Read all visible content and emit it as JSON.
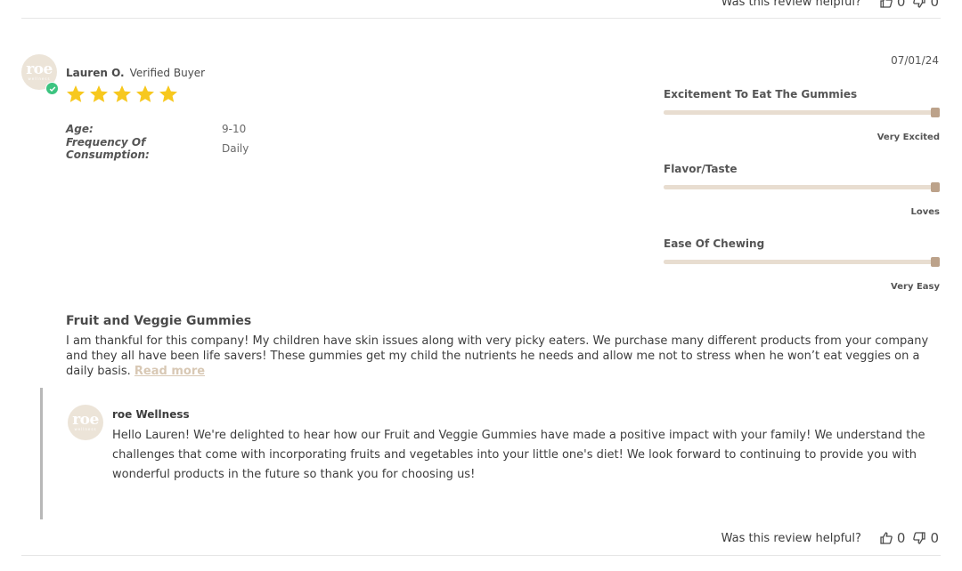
{
  "helpful": {
    "label": "Was this review helpful?",
    "upvotes": "0",
    "downvotes": "0"
  },
  "review": {
    "reviewer_name": "Lauren O.",
    "verified_label": "Verified Buyer",
    "date": "07/01/24",
    "rating": 5,
    "avatar_logo": "roe",
    "avatar_logo_sub": "wellness",
    "attributes": [
      {
        "key": "Age:",
        "value": "9-10"
      },
      {
        "key": "Frequency Of Consumption:",
        "value": "Daily"
      }
    ],
    "sliders": [
      {
        "title": "Excitement To Eat The Gummies",
        "value_label": "Very Excited",
        "level": 1.0
      },
      {
        "title": "Flavor/Taste",
        "value_label": "Loves",
        "level": 1.0
      },
      {
        "title": "Ease Of Chewing",
        "value_label": "Very Easy",
        "level": 1.0
      }
    ],
    "title": "Fruit and Veggie Gummies",
    "body": "I am thankful for this company! My children have skin issues along with very picky eaters. We purchase many different products from your company and they all have been life savers! These gummies get my child the nutrients he needs and allow me not to stress when he won’t eat veggies on a daily basis.",
    "read_more": "Read more"
  },
  "reply": {
    "name": "roe Wellness",
    "body": "Hello Lauren! We're delighted to hear how our Fruit and Veggie Gummies have made a positive impact with your family! We understand the challenges that come with incorporating fruits and vegetables into your little one's diet! We look forward to continuing to provide you with wonderful products in the future so thank you for choosing us!"
  },
  "colors": {
    "star": "#f7c81e",
    "verified_badge": "#3cc480",
    "slider_track": "#e8ddd0",
    "slider_knob": "#bca28a",
    "read_more": "#d8c8b4",
    "avatar_bg": "#ece4d8"
  },
  "icons": {
    "thumbs_up": "thumbs-up-icon",
    "thumbs_down": "thumbs-down-icon",
    "star": "star-icon",
    "check": "check-icon"
  }
}
